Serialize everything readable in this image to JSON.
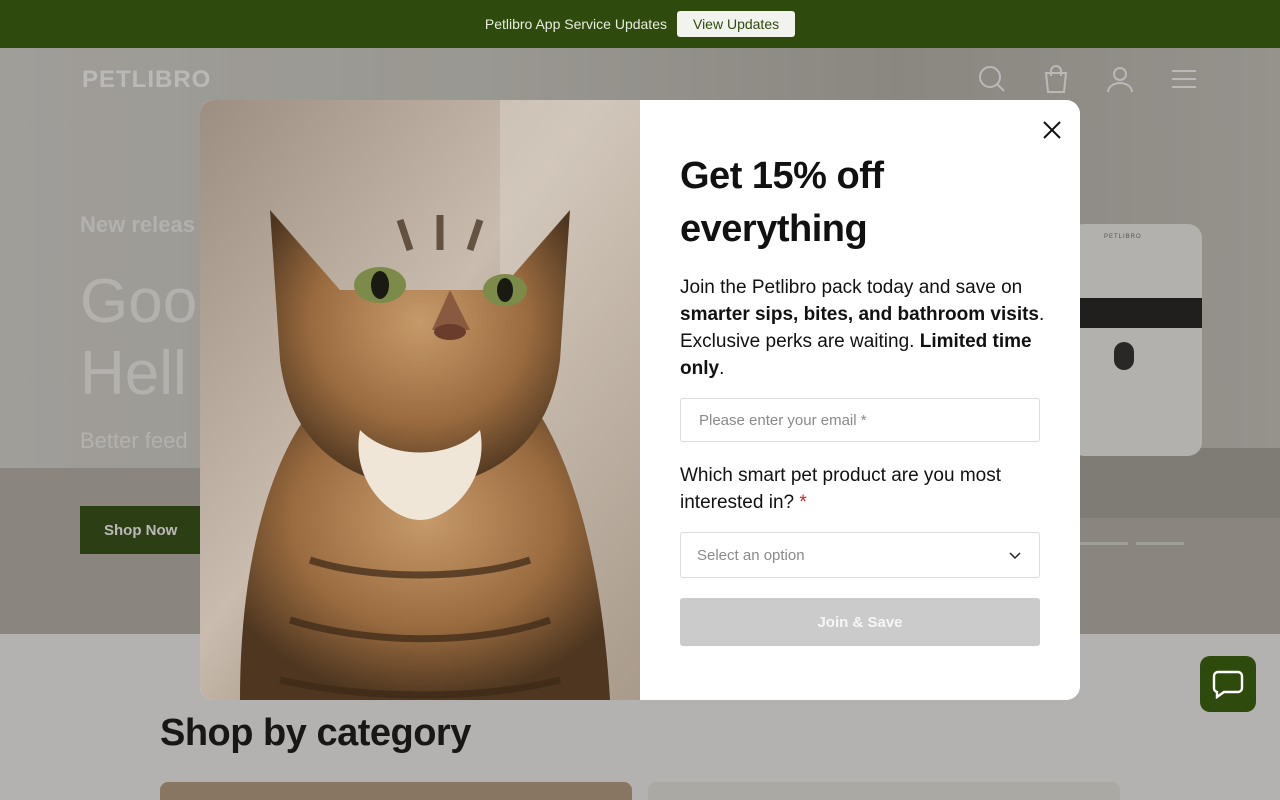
{
  "announcement": {
    "text": "Petlibro App Service Updates",
    "button_label": "View Updates"
  },
  "header": {
    "logo": "PETLIBRO",
    "icons": [
      "search-icon",
      "cart-icon",
      "account-icon",
      "menu-icon"
    ]
  },
  "hero": {
    "eyebrow": "New releas",
    "headline_line1": "Goo",
    "headline_line2": "Hell",
    "subtitle": "Better feed",
    "cta_label": "Shop Now",
    "feeder_brand": "PETLIBRO"
  },
  "category_section": {
    "title": "Shop by category"
  },
  "popup": {
    "title": "Get 15% off everything",
    "description_part1": "Join the Petlibro pack today and save on ",
    "description_bold1": "smarter sips, bites, and bathroom visits",
    "description_part2": ". Exclusive perks are waiting. ",
    "description_bold2": "Limited time only",
    "description_part3": ".",
    "email_placeholder": "Please enter your email *",
    "question": "Which smart pet product are you most interested in?",
    "question_required_mark": "*",
    "select_value": "Select an option",
    "submit_label": "Join & Save"
  },
  "colors": {
    "brand_green": "#2e4a0c",
    "required_red": "#d0261c",
    "disabled_button": "#cbcbcb"
  }
}
